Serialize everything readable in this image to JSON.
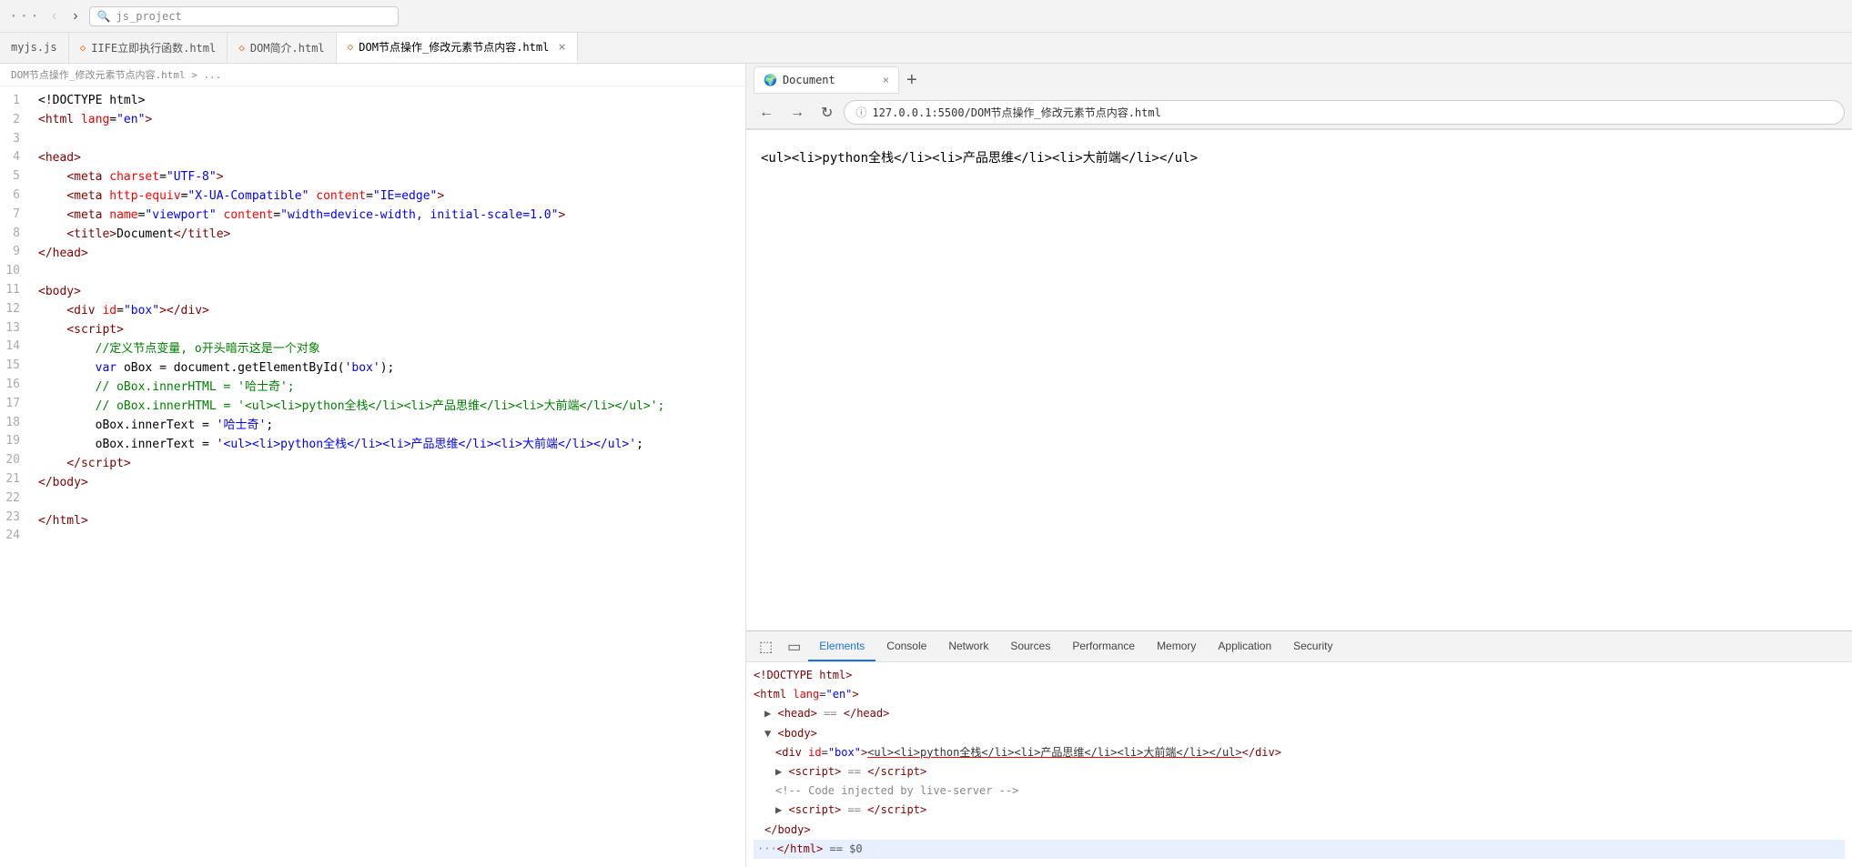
{
  "topbar": {
    "search_placeholder": "js_project",
    "nav_back": "‹",
    "nav_forward": "›",
    "dots": "···"
  },
  "tabs": [
    {
      "id": "myjs",
      "label": "myjs.js",
      "icon": "",
      "active": false,
      "closable": false
    },
    {
      "id": "iife",
      "label": "IIFE立即执行函数.html",
      "icon": "◇",
      "active": false,
      "closable": false
    },
    {
      "id": "dom-intro",
      "label": "DOM简介.html",
      "icon": "◇",
      "active": false,
      "closable": false
    },
    {
      "id": "dom-node",
      "label": "DOM节点操作_修改元素节点内容.html",
      "icon": "◇",
      "active": true,
      "closable": true
    }
  ],
  "breadcrumb": "DOM节点操作_修改元素节点内容.html > ...",
  "code_lines": [
    {
      "num": "1",
      "html": "<span class='plain'>&lt;!DOCTYPE html&gt;</span>"
    },
    {
      "num": "2",
      "html": "<span class='tag'>&lt;html</span> <span class='attr'>lang</span><span class='punct'>=</span><span class='val'>\"en\"</span><span class='tag'>&gt;</span>"
    },
    {
      "num": "3",
      "html": ""
    },
    {
      "num": "4",
      "html": "<span class='tag'>&lt;head&gt;</span>"
    },
    {
      "num": "5",
      "html": "    <span class='tag'>&lt;meta</span> <span class='attr'>charset</span><span class='punct'>=</span><span class='val'>\"UTF-8\"</span><span class='tag'>&gt;</span>"
    },
    {
      "num": "6",
      "html": "    <span class='tag'>&lt;meta</span> <span class='attr'>http-equiv</span><span class='punct'>=</span><span class='val'>\"X-UA-Compatible\"</span> <span class='attr'>content</span><span class='punct'>=</span><span class='val'>\"IE=edge\"</span><span class='tag'>&gt;</span>"
    },
    {
      "num": "7",
      "html": "    <span class='tag'>&lt;meta</span> <span class='attr'>name</span><span class='punct'>=</span><span class='val'>\"viewport\"</span> <span class='attr'>content</span><span class='punct'>=</span><span class='val'>\"width=device-width, initial-scale=1.0\"</span><span class='tag'>&gt;</span>"
    },
    {
      "num": "8",
      "html": "    <span class='tag'>&lt;title&gt;</span><span class='plain'>Document</span><span class='tag'>&lt;/title&gt;</span>"
    },
    {
      "num": "9",
      "html": "<span class='tag'>&lt;/head&gt;</span>"
    },
    {
      "num": "10",
      "html": ""
    },
    {
      "num": "11",
      "html": "<span class='tag'>&lt;body&gt;</span>"
    },
    {
      "num": "12",
      "html": "    <span class='tag'>&lt;div</span> <span class='attr'>id</span><span class='punct'>=</span><span class='val'>\"box\"</span><span class='tag'>&gt;&lt;/div&gt;</span>"
    },
    {
      "num": "13",
      "html": "    <span class='tag'>&lt;script&gt;</span>"
    },
    {
      "num": "14",
      "html": "        <span class='comment'>//定义节点变量, o开头暗示这是一个对象</span>"
    },
    {
      "num": "15",
      "html": "        <span class='kw'>var</span> <span class='plain'>oBox = document.getElementById(</span><span class='str'>'box'</span><span class='plain'>);</span>"
    },
    {
      "num": "16",
      "html": "        <span class='comment'>// oBox.innerHTML = '哈士奇';</span>"
    },
    {
      "num": "17",
      "html": "        <span class='comment'>// oBox.innerHTML = '&lt;ul&gt;&lt;li&gt;python全栈&lt;/li&gt;&lt;li&gt;产品思维&lt;/li&gt;&lt;li&gt;大前端&lt;/li&gt;&lt;/ul&gt;';</span>"
    },
    {
      "num": "18",
      "html": "        <span class='plain'>oBox.innerText = </span><span class='str'>'哈士奇'</span><span class='plain'>;</span>"
    },
    {
      "num": "19",
      "html": "        <span class='plain'>oBox.innerText = </span><span class='str'>'&lt;ul&gt;&lt;li&gt;python全栈&lt;/li&gt;&lt;li&gt;产品思维&lt;/li&gt;&lt;li&gt;大前端&lt;/li&gt;&lt;/ul&gt;'</span><span class='plain'>;</span>"
    },
    {
      "num": "20",
      "html": "    <span class='tag'>&lt;/script&gt;</span>"
    },
    {
      "num": "21",
      "html": "<span class='tag'>&lt;/body&gt;</span>"
    },
    {
      "num": "22",
      "html": ""
    },
    {
      "num": "23",
      "html": "<span class='tag'>&lt;/html&gt;</span>"
    },
    {
      "num": "24",
      "html": ""
    }
  ],
  "browser": {
    "tab_title": "Document",
    "tab_icon": "🌍",
    "close_icon": "×",
    "new_tab_icon": "+",
    "nav_back": "←",
    "nav_forward": "→",
    "nav_refresh": "↻",
    "address": "127.0.0.1:5500/DOM节点操作_修改元素节点内容.html",
    "address_icon": "ⓘ",
    "page_content": "<ul><li>python全栈</li><li>产品思维</li><li>大前端</li></ul>"
  },
  "devtools": {
    "icon_inspect": "⬚",
    "icon_device": "▭",
    "tabs": [
      "Elements",
      "Console",
      "Network",
      "Sources",
      "Performance",
      "Memory",
      "Application",
      "Security"
    ],
    "active_tab": "Elements",
    "lines": [
      {
        "indent": 0,
        "html": "<span class='dt-tag'>&lt;!DOCTYPE html&gt;</span>"
      },
      {
        "indent": 0,
        "html": "<span class='dt-tag'>&lt;html</span> <span class='dt-attr'>lang</span>=<span class='dt-val'>\"en\"</span><span class='dt-tag'>&gt;</span>"
      },
      {
        "indent": 1,
        "html": "<span class='dt-triangle'>▶</span> <span class='dt-tag'>&lt;head&gt;</span> <span class='dt-comment'>== </span><span class='dt-tag'>&lt;/head&gt;</span>"
      },
      {
        "indent": 1,
        "html": "<span class='dt-triangle'>▼</span> <span class='dt-tag'>&lt;body&gt;</span>"
      },
      {
        "indent": 2,
        "html": "<span class='dt-tag'>&lt;div</span> <span class='dt-attr'>id</span>=<span class='dt-val'>\"box\"</span><span class='dt-tag'>&gt;</span><span class='dt-underline'>&lt;ul&gt;&lt;li&gt;python全栈&lt;/li&gt;&lt;li&gt;产品思维&lt;/li&gt;&lt;li&gt;大前端&lt;/li&gt;&lt;/ul&gt;</span><span class='dt-tag'>&lt;/div&gt;</span>"
      },
      {
        "indent": 2,
        "html": "<span class='dt-triangle'>▶</span> <span class='dt-tag'>&lt;script&gt;</span> <span class='dt-comment'>== </span><span class='dt-tag'>&lt;/script&gt;</span>"
      },
      {
        "indent": 2,
        "html": "<span class='dt-comment'>&lt;!-- Code injected by live-server --&gt;</span>"
      },
      {
        "indent": 2,
        "html": "<span class='dt-triangle'>▶</span> <span class='dt-tag'>&lt;script&gt;</span> <span class='dt-comment'>== </span><span class='dt-tag'>&lt;/script&gt;</span>"
      },
      {
        "indent": 1,
        "html": "<span class='dt-tag'>&lt;/body&gt;</span>"
      }
    ],
    "selected_line": "···</html> == $0"
  }
}
